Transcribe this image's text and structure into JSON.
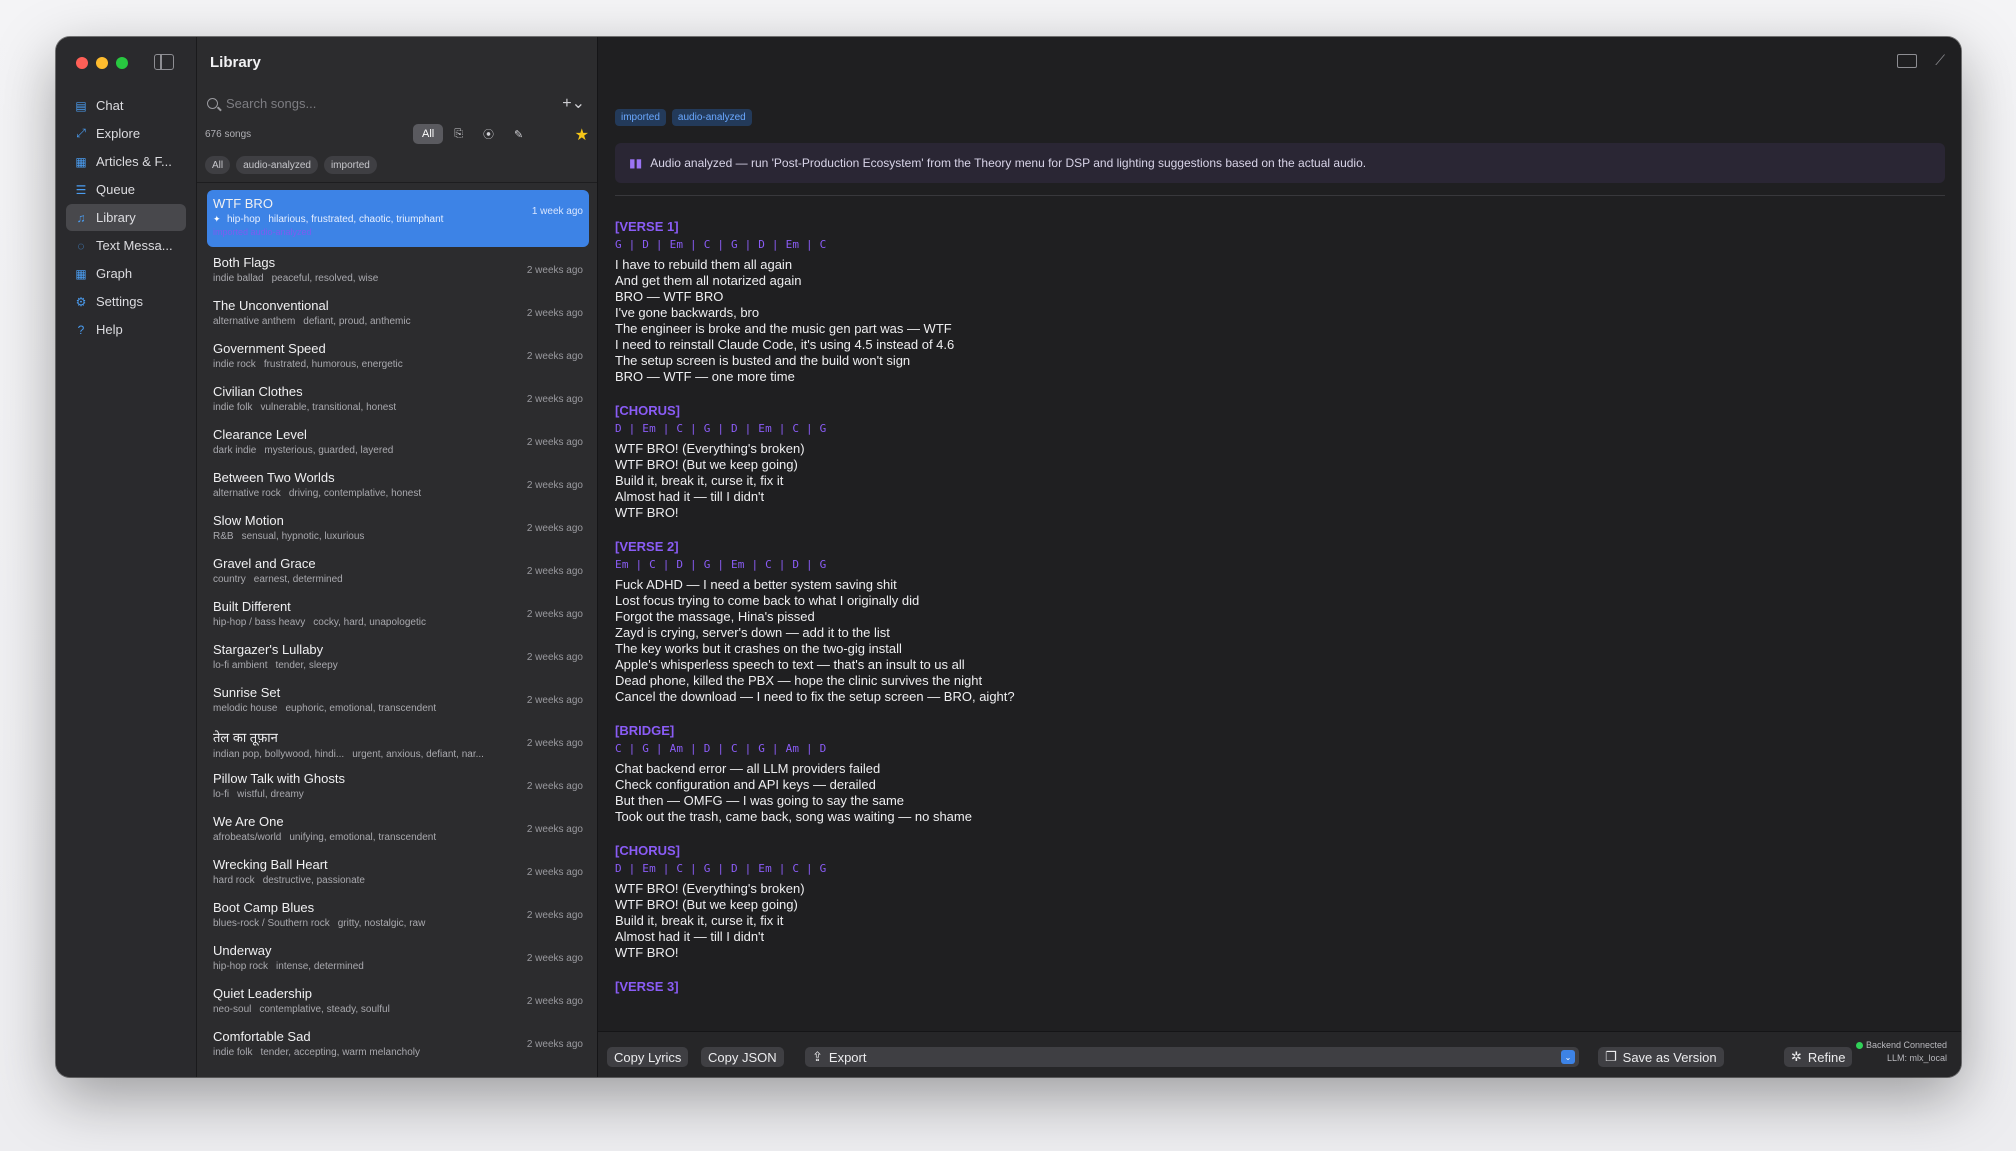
{
  "window": {
    "title": "Library"
  },
  "sidebar": {
    "items": [
      {
        "label": "Chat",
        "icon": "chat-icon",
        "glyph": "▤"
      },
      {
        "label": "Explore",
        "icon": "explore-icon",
        "glyph": "⤢"
      },
      {
        "label": "Articles & F...",
        "icon": "articles-icon",
        "glyph": "▦"
      },
      {
        "label": "Queue",
        "icon": "queue-icon",
        "glyph": "☰"
      },
      {
        "label": "Library",
        "icon": "library-icon",
        "glyph": "♫",
        "active": true
      },
      {
        "label": "Text Messa...",
        "icon": "message-icon",
        "glyph": "◌"
      },
      {
        "label": "Graph",
        "icon": "graph-icon",
        "glyph": "▦"
      },
      {
        "label": "Settings",
        "icon": "gear-icon",
        "glyph": "⚙"
      },
      {
        "label": "Help",
        "icon": "help-icon",
        "glyph": "?"
      }
    ]
  },
  "list": {
    "search_placeholder": "Search songs...",
    "add_label": "+⌄",
    "count": "676 songs",
    "filters": {
      "all": "All",
      "chat_glyph": "⎘",
      "radio_glyph": "⦿",
      "pen_glyph": "✎",
      "star_glyph": "★"
    },
    "chips": [
      "All",
      "audio-analyzed",
      "imported"
    ],
    "songs": [
      {
        "title": "WTF BRO",
        "genre": "hip-hop",
        "moods": "hilarious, frustrated, chaotic, triumphant",
        "time": "1 week ago",
        "tags": "imported  audio-analyzed",
        "selected": true
      },
      {
        "title": "Both Flags",
        "genre": "indie ballad",
        "moods": "peaceful, resolved, wise",
        "time": "2 weeks ago"
      },
      {
        "title": "The Unconventional",
        "genre": "alternative anthem",
        "moods": "defiant, proud, anthemic",
        "time": "2 weeks ago"
      },
      {
        "title": "Government Speed",
        "genre": "indie rock",
        "moods": "frustrated, humorous, energetic",
        "time": "2 weeks ago"
      },
      {
        "title": "Civilian Clothes",
        "genre": "indie folk",
        "moods": "vulnerable, transitional, honest",
        "time": "2 weeks ago"
      },
      {
        "title": "Clearance Level",
        "genre": "dark indie",
        "moods": "mysterious, guarded, layered",
        "time": "2 weeks ago"
      },
      {
        "title": "Between Two Worlds",
        "genre": "alternative rock",
        "moods": "driving, contemplative, honest",
        "time": "2 weeks ago"
      },
      {
        "title": "Slow Motion",
        "genre": "R&B",
        "moods": "sensual, hypnotic, luxurious",
        "time": "2 weeks ago"
      },
      {
        "title": "Gravel and Grace",
        "genre": "country",
        "moods": "earnest, determined",
        "time": "2 weeks ago"
      },
      {
        "title": "Built Different",
        "genre": "hip-hop / bass heavy",
        "moods": "cocky, hard, unapologetic",
        "time": "2 weeks ago"
      },
      {
        "title": "Stargazer's Lullaby",
        "genre": "lo-fi ambient",
        "moods": "tender, sleepy",
        "time": "2 weeks ago"
      },
      {
        "title": "Sunrise Set",
        "genre": "melodic house",
        "moods": "euphoric, emotional, transcendent",
        "time": "2 weeks ago"
      },
      {
        "title": "तेल का तूफ़ान",
        "genre": "indian pop, bollywood, hindi...",
        "moods": "urgent, anxious, defiant, nar...",
        "time": "2 weeks ago"
      },
      {
        "title": "Pillow Talk with Ghosts",
        "genre": "lo-fi",
        "moods": "wistful, dreamy",
        "time": "2 weeks ago"
      },
      {
        "title": "We Are One",
        "genre": "afrobeats/world",
        "moods": "unifying, emotional, transcendent",
        "time": "2 weeks ago"
      },
      {
        "title": "Wrecking Ball Heart",
        "genre": "hard rock",
        "moods": "destructive, passionate",
        "time": "2 weeks ago"
      },
      {
        "title": "Boot Camp Blues",
        "genre": "blues-rock / Southern rock",
        "moods": "gritty, nostalgic, raw",
        "time": "2 weeks ago"
      },
      {
        "title": "Underway",
        "genre": "hip-hop rock",
        "moods": "intense, determined",
        "time": "2 weeks ago"
      },
      {
        "title": "Quiet Leadership",
        "genre": "neo-soul",
        "moods": "contemplative, steady, soulful",
        "time": "2 weeks ago"
      },
      {
        "title": "Comfortable Sad",
        "genre": "indie folk",
        "moods": "tender, accepting, warm melancholy",
        "time": "2 weeks ago"
      }
    ]
  },
  "detail": {
    "tags": [
      "imported",
      "audio-analyzed"
    ],
    "notice": "Audio analyzed — run 'Post-Production Ecosystem' from the Theory menu for DSP and lighting suggestions based on the actual audio.",
    "sections": [
      {
        "label": "[VERSE 1]",
        "chords": "G | D | Em | C | G | D | Em | C",
        "lines": [
          "I have to rebuild them all again",
          "And get them all notarized again",
          "BRO — WTF BRO",
          "I've gone backwards, bro",
          "The engineer is broke and the music gen part was — WTF",
          "I need to reinstall Claude Code, it's using 4.5 instead of 4.6",
          "The setup screen is busted and the build won't sign",
          "BRO — WTF — one more time"
        ]
      },
      {
        "label": "[CHORUS]",
        "chords": "D | Em | C | G | D | Em | C | G",
        "lines": [
          "WTF BRO! (Everything's broken)",
          "WTF BRO! (But we keep going)",
          "Build it, break it, curse it, fix it",
          "Almost had it — till I didn't",
          "WTF BRO!"
        ]
      },
      {
        "label": "[VERSE 2]",
        "chords": "Em | C | D | G | Em | C | D | G",
        "lines": [
          "Fuck ADHD — I need a better system saving shit",
          "Lost focus trying to come back to what I originally did",
          "Forgot the massage, Hina's pissed",
          "Zayd is crying, server's down — add it to the list",
          "The key works but it crashes on the two-gig install",
          "Apple's whisperless speech to text — that's an insult to us all",
          "Dead phone, killed the PBX — hope the clinic survives the night",
          "Cancel the download — I need to fix the setup screen — BRO, aight?"
        ]
      },
      {
        "label": "[BRIDGE]",
        "chords": "C | G | Am | D | C | G | Am | D",
        "lines": [
          "Chat backend error — all LLM providers failed",
          "Check configuration and API keys — derailed",
          "But then — OMFG — I was going to say the same",
          "Took out the trash, came back, song was waiting — no shame"
        ]
      },
      {
        "label": "[CHORUS]",
        "chords": "D | Em | C | G | D | Em | C | G",
        "lines": [
          "WTF BRO! (Everything's broken)",
          "WTF BRO! (But we keep going)",
          "Build it, break it, curse it, fix it",
          "Almost had it — till I didn't",
          "WTF BRO!"
        ]
      },
      {
        "label": "[VERSE 3]",
        "chords": "",
        "lines": []
      }
    ]
  },
  "bottom": {
    "copy_lyrics": "Copy Lyrics",
    "copy_json": "Copy JSON",
    "export": "Export",
    "save_version": "Save as Version",
    "refine": "Refine",
    "status_connected": "Backend Connected",
    "status_llm": "LLM: mlx_local"
  }
}
